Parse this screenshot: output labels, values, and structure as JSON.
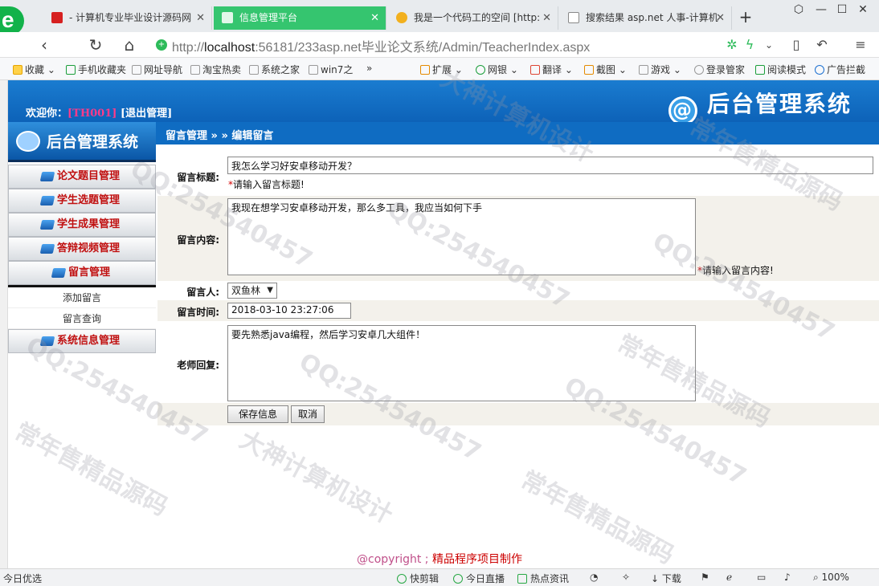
{
  "browser": {
    "logo": "e",
    "tabs": [
      {
        "title": "- 计算机专业毕业设计源码网",
        "color": "#d62020"
      },
      {
        "title": "信息管理平台",
        "color": "#ffffff"
      },
      {
        "title": "我是一个代码工的空间 [http:",
        "color": "#f2b01e"
      },
      {
        "title": "搜索结果 asp.net 人事-计算机",
        "color": "#888888"
      }
    ],
    "tab_close": "✕",
    "new_tab": "+",
    "url_host": "localhost",
    "url_prefix": "http://",
    "url_rest": ":56181/233asp.net毕业论文系统/Admin/TeacherIndex.aspx",
    "bookmarks": [
      "收藏",
      "手机收藏夹",
      "网址导航",
      "淘宝热卖",
      "系统之家",
      "win7之",
      "»",
      "扩展",
      "网银",
      "翻译",
      "截图",
      "游戏",
      "登录管家",
      "阅读模式",
      "广告拦截"
    ]
  },
  "header": {
    "welcome_prefix": "欢迎你：",
    "user_id": "[TH001]",
    "logout": "[退出管理]",
    "logo_text": "后台管理系统",
    "at_symbol": "@"
  },
  "sidebar": {
    "logo_text": "后台管理系统",
    "items": [
      {
        "label": "论文题目管理"
      },
      {
        "label": "学生选题管理"
      },
      {
        "label": "学生成果管理"
      },
      {
        "label": "答辩视频管理"
      },
      {
        "label": "留言管理"
      }
    ],
    "sub_items": [
      {
        "label": "添加留言"
      },
      {
        "label": "留言查询"
      }
    ],
    "last_item": {
      "label": "系统信息管理"
    }
  },
  "breadcrumb": "留言管理 » » 编辑留言",
  "form": {
    "title_label": "留言标题:",
    "title_value": "我怎么学习好安卓移动开发？",
    "title_hint": "请输入留言标题!",
    "content_label": "留言内容:",
    "content_value": "我现在想学习安卓移动开发，那么多工具，我应当如何下手",
    "content_hint": "请输入留言内容!",
    "person_label": "留言人:",
    "person_value": "双鱼林",
    "time_label": "留言时间:",
    "time_value": "2018-03-10 23:27:06",
    "reply_label": "老师回复:",
    "reply_value": "要先熟悉java编程，然后学习安卓几大组件！",
    "star": "*",
    "save_label": "保存信息",
    "cancel_label": "取消"
  },
  "footer": {
    "prefix": "@copyright ; ",
    "text": "精品程序项目制作"
  },
  "statusbar": {
    "left": "今日优选",
    "items": [
      "快剪辑",
      "今日直播",
      "热点资讯",
      "下载"
    ],
    "zoom": "100%"
  },
  "watermarks": [
    "常年售精品源码",
    "QQ:254540457",
    "大神计算机设计"
  ]
}
